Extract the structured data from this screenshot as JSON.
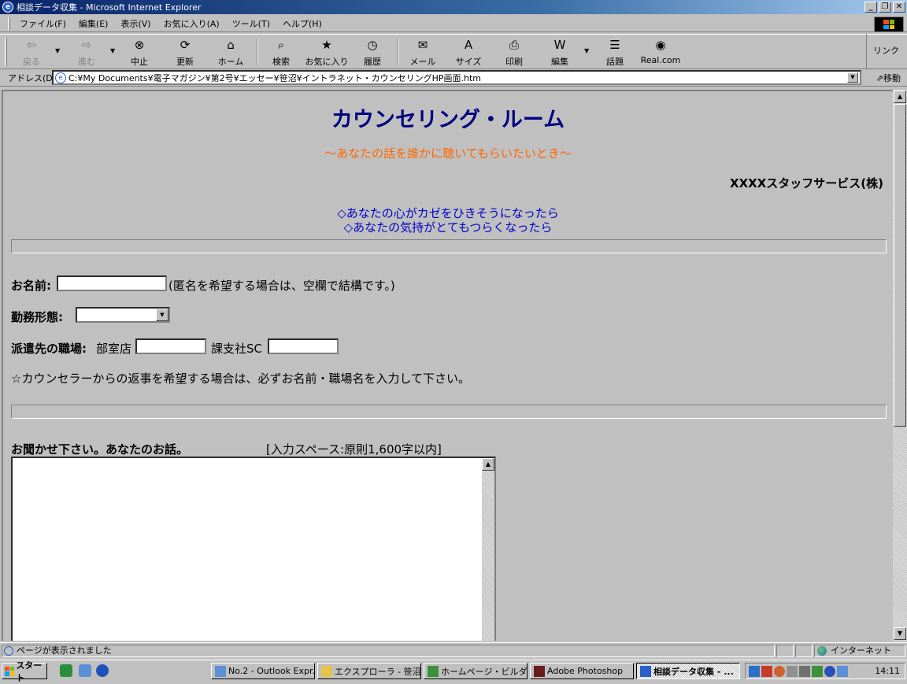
{
  "window": {
    "title": "相談データ収集 - Microsoft Internet Explorer",
    "buttons": [
      "_",
      "❐",
      "✕"
    ]
  },
  "menubar": {
    "items": [
      "ファイル(F)",
      "編集(E)",
      "表示(V)",
      "お気に入り(A)",
      "ツール(T)",
      "ヘルプ(H)"
    ]
  },
  "toolbar": {
    "buttons": [
      {
        "label": "戻る",
        "icon": "back-arrow-icon",
        "glyph": "⇦",
        "enabled": false
      },
      {
        "label": "進む",
        "icon": "forward-arrow-icon",
        "glyph": "⇨",
        "enabled": false
      },
      {
        "label": "中止",
        "icon": "stop-icon",
        "glyph": "⊗",
        "enabled": true
      },
      {
        "label": "更新",
        "icon": "refresh-icon",
        "glyph": "⟳",
        "enabled": true
      },
      {
        "label": "ホーム",
        "icon": "home-icon",
        "glyph": "⌂",
        "enabled": true
      },
      {
        "label": "検索",
        "icon": "search-icon",
        "glyph": "⌕",
        "enabled": true
      },
      {
        "label": "お気に入り",
        "icon": "favorites-icon",
        "glyph": "★",
        "enabled": true
      },
      {
        "label": "履歴",
        "icon": "history-icon",
        "glyph": "◷",
        "enabled": true
      },
      {
        "label": "メール",
        "icon": "mail-icon",
        "glyph": "✉",
        "enabled": true
      },
      {
        "label": "サイズ",
        "icon": "font-size-icon",
        "glyph": "A",
        "enabled": true
      },
      {
        "label": "印刷",
        "icon": "print-icon",
        "glyph": "⎙",
        "enabled": true
      },
      {
        "label": "編集",
        "icon": "edit-icon",
        "glyph": "W",
        "enabled": true
      },
      {
        "label": "話題",
        "icon": "discuss-icon",
        "glyph": "☰",
        "enabled": true
      },
      {
        "label": "Real.com",
        "icon": "realcom-icon",
        "glyph": "◉",
        "enabled": true
      }
    ],
    "links_label": "リンク"
  },
  "address": {
    "label": "アドレス(D)",
    "value": "C:¥My Documents¥電子マガジン¥第2号¥エッセー¥笹沼¥イントラネット・カウンセリングHP画面.htm",
    "go_label": "移動"
  },
  "page": {
    "title": "カウンセリング・ルーム",
    "subtitle": "～あなたの話を誰かに聴いてもらいたいとき～",
    "company": "XXXXスタッフサービス(株)",
    "link1": "◇あなたの心がカゼをひきそうになったら",
    "link2": "◇あなたの気持がとてもつらくなったら",
    "name_label": "お名前:",
    "name_note": "(匿名を希望する場合は、空欄で結構です。)",
    "employment_label": "勤務形態:",
    "workplace_label": "派遣先の職場:",
    "dept_label": "部室店",
    "section_label": "課支社SC",
    "notice": "☆カウンセラーからの返事を希望する場合は、必ずお名前・職場名を入力して下さい。",
    "story_label": "お聞かせ下さい。あなたのお話。",
    "story_hint": "[入力スペース:原則1,600字以内]"
  },
  "status": {
    "text": "ページが表示されました",
    "zone": "インターネット"
  },
  "taskbar": {
    "start_label": "スタート",
    "tasks": [
      {
        "label": "No.2 - Outlook Expr...",
        "active": false
      },
      {
        "label": "エクスプローラ - 笹沼",
        "active": false
      },
      {
        "label": "ホームページ・ビルダ...",
        "active": false
      },
      {
        "label": "Adobe Photoshop",
        "active": false
      },
      {
        "label": "相談データ収集 - ...",
        "active": true
      }
    ],
    "clock": "14:11"
  }
}
